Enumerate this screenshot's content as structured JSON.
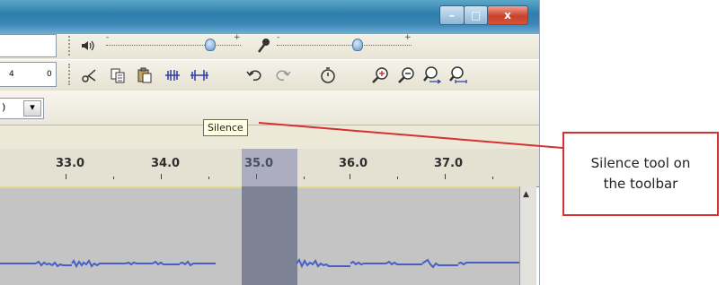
{
  "window": {
    "controls": {
      "minimize": "–",
      "maximize": "□",
      "close": "x"
    }
  },
  "toolbar": {
    "field_values": {
      "a": "4",
      "b": "0"
    },
    "playback_slider": {
      "icon": "speaker-icon",
      "min": "-",
      "max": "+"
    },
    "record_slider": {
      "icon": "microphone-icon",
      "min": "-",
      "max": "+"
    },
    "edit_tools": [
      {
        "name": "cut-icon"
      },
      {
        "name": "copy-icon"
      },
      {
        "name": "paste-icon"
      },
      {
        "name": "trim-icon"
      },
      {
        "name": "silence-icon"
      },
      {
        "name": "undo-icon"
      },
      {
        "name": "redo-icon"
      },
      {
        "name": "sync-lock-icon"
      },
      {
        "name": "zoom-in-icon"
      },
      {
        "name": "zoom-out-icon"
      },
      {
        "name": "fit-selection-icon"
      },
      {
        "name": "fit-project-icon"
      }
    ],
    "dropdown_arrow": "▾",
    "dropdown_value": ")"
  },
  "tooltip": {
    "text": "Silence"
  },
  "ruler": {
    "labels": [
      "33.0",
      "34.0",
      "35.0",
      "36.0",
      "37.0"
    ]
  },
  "callout": {
    "line1": "Silence tool on",
    "line2": "the toolbar"
  },
  "colors": {
    "selection": "#7d8295",
    "waveform": "#4a5fc6",
    "callout_border": "#d53133"
  }
}
